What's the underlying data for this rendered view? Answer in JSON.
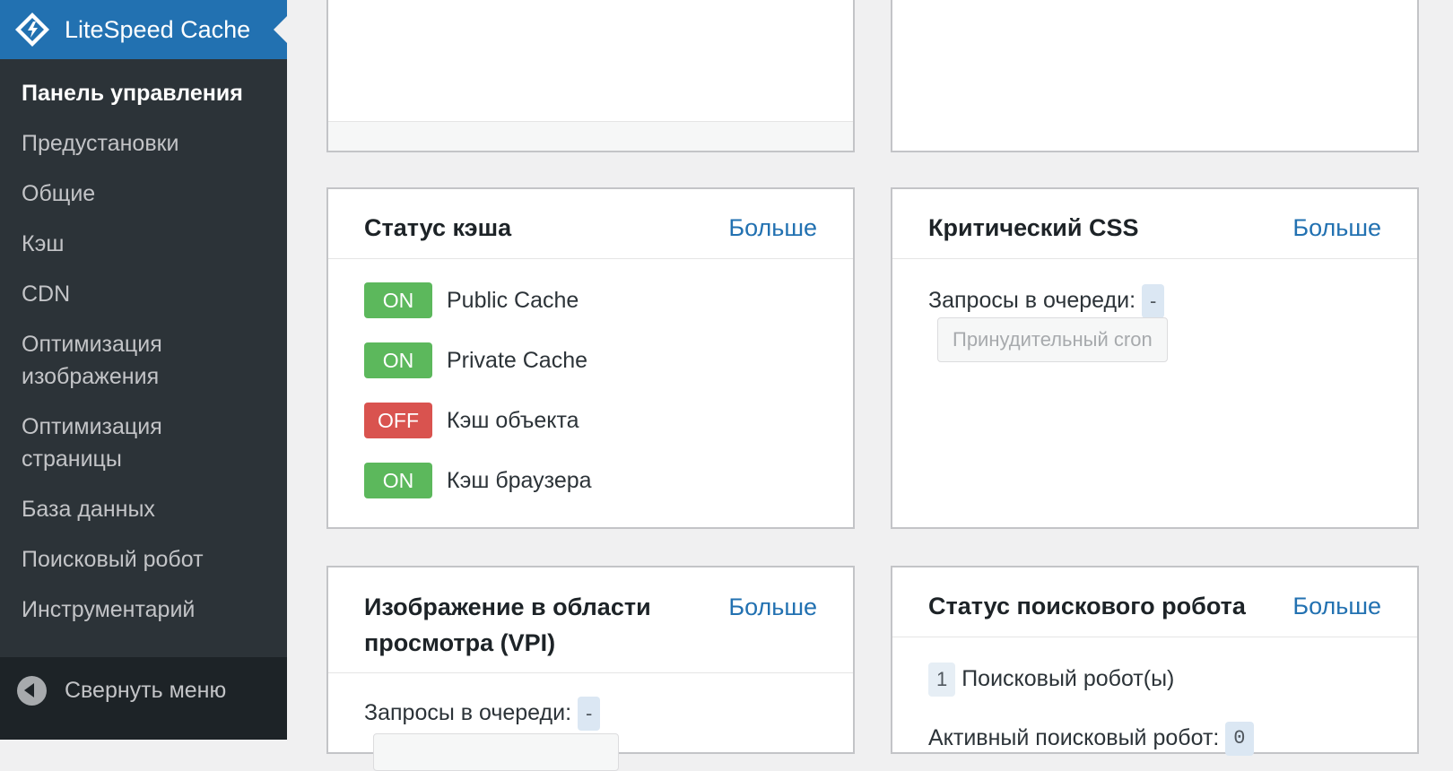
{
  "sidebar": {
    "title": "LiteSpeed Cache",
    "items": [
      {
        "label": "Панель управления",
        "active": true
      },
      {
        "label": "Предустановки"
      },
      {
        "label": "Общие"
      },
      {
        "label": "Кэш"
      },
      {
        "label": "CDN"
      },
      {
        "label": "Оптимизация изображения"
      },
      {
        "label": "Оптимизация страницы"
      },
      {
        "label": "База данных"
      },
      {
        "label": "Поисковый робот"
      },
      {
        "label": "Инструментарий"
      }
    ],
    "collapse_label": "Свернуть меню"
  },
  "cache_status": {
    "title": "Статус кэша",
    "more": "Больше",
    "rows": [
      {
        "state": "ON",
        "label": "Public Cache"
      },
      {
        "state": "ON",
        "label": "Private Cache"
      },
      {
        "state": "OFF",
        "label": "Кэш объекта"
      },
      {
        "state": "ON",
        "label": "Кэш браузера"
      }
    ]
  },
  "critical_css": {
    "title": "Критический CSS",
    "more": "Больше",
    "queue_label": "Запросы в очереди:",
    "queue_value": "-",
    "button": "Принудительный cron"
  },
  "vpi": {
    "title": "Изображение в области просмотра (VPI)",
    "more": "Больше",
    "queue_label": "Запросы в очереди:",
    "queue_value": "-"
  },
  "crawler_status": {
    "title": "Статус поискового робота",
    "more": "Больше",
    "count": "1",
    "count_label": "Поисковый робот(ы)",
    "active_label": "Активный поисковый робот:",
    "active_value": "0"
  },
  "colors": {
    "sidebar_bg": "#2c3338",
    "header_bg": "#2271b1",
    "on": "#5cb85c",
    "off": "#d9534f",
    "link": "#2271b1"
  }
}
